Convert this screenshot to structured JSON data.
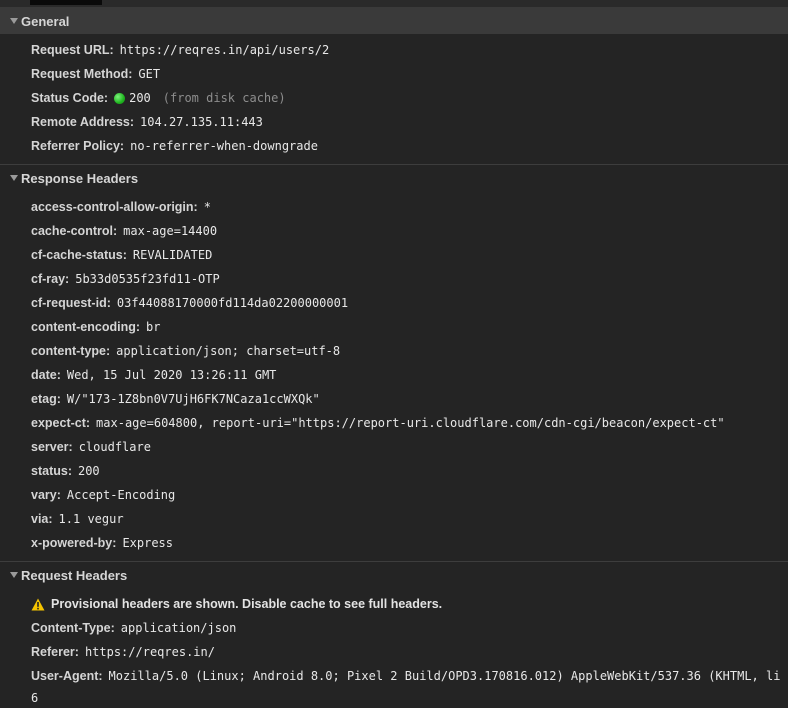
{
  "general": {
    "title": "General",
    "request_url": {
      "key": "Request URL:",
      "value": "https://reqres.in/api/users/2"
    },
    "request_method": {
      "key": "Request Method:",
      "value": "GET"
    },
    "status_code": {
      "key": "Status Code:",
      "value": "200",
      "note": "(from disk cache)",
      "status_color": "#1fb51f"
    },
    "remote_address": {
      "key": "Remote Address:",
      "value": "104.27.135.11:443"
    },
    "referrer_policy": {
      "key": "Referrer Policy:",
      "value": "no-referrer-when-downgrade"
    }
  },
  "response_headers": {
    "title": "Response Headers",
    "items": [
      {
        "key": "access-control-allow-origin:",
        "value": "*"
      },
      {
        "key": "cache-control:",
        "value": "max-age=14400"
      },
      {
        "key": "cf-cache-status:",
        "value": "REVALIDATED"
      },
      {
        "key": "cf-ray:",
        "value": "5b33d0535f23fd11-OTP"
      },
      {
        "key": "cf-request-id:",
        "value": "03f44088170000fd114da02200000001"
      },
      {
        "key": "content-encoding:",
        "value": "br"
      },
      {
        "key": "content-type:",
        "value": "application/json; charset=utf-8"
      },
      {
        "key": "date:",
        "value": "Wed, 15 Jul 2020 13:26:11 GMT"
      },
      {
        "key": "etag:",
        "value": "W/\"173-1Z8bn0V7UjH6FK7NCaza1ccWXQk\""
      },
      {
        "key": "expect-ct:",
        "value": "max-age=604800, report-uri=\"https://report-uri.cloudflare.com/cdn-cgi/beacon/expect-ct\""
      },
      {
        "key": "server:",
        "value": "cloudflare"
      },
      {
        "key": "status:",
        "value": "200"
      },
      {
        "key": "vary:",
        "value": "Accept-Encoding"
      },
      {
        "key": "via:",
        "value": "1.1 vegur"
      },
      {
        "key": "x-powered-by:",
        "value": "Express"
      }
    ]
  },
  "request_headers": {
    "title": "Request Headers",
    "warning": "Provisional headers are shown. Disable cache to see full headers.",
    "warning_icon": "warning-icon",
    "items": [
      {
        "key": "Content-Type:",
        "value": "application/json"
      },
      {
        "key": "Referer:",
        "value": "https://reqres.in/"
      },
      {
        "key": "User-Agent:",
        "value": "Mozilla/5.0 (Linux; Android 8.0; Pixel 2 Build/OPD3.170816.012) AppleWebKit/537.36 (KHTML, li"
      }
    ],
    "user_agent_wrap": "6"
  }
}
